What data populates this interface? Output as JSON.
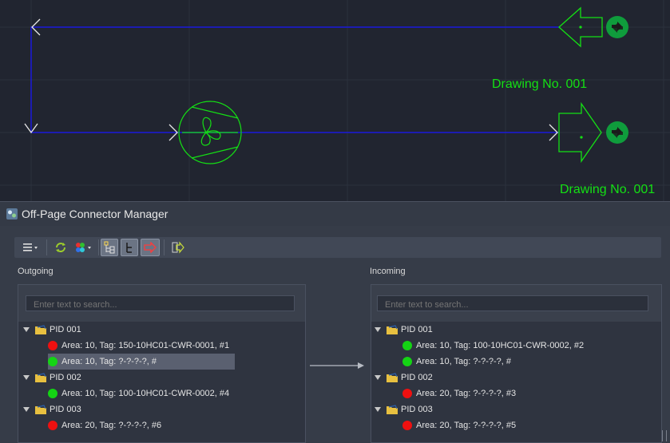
{
  "canvas": {
    "labels": [
      "Drawing No. 001",
      "Drawing No. 001"
    ],
    "line_color": "#1a1adc",
    "symbol_color": "#14e014",
    "background": "#212530"
  },
  "window": {
    "title": "Off-Page Connector Manager"
  },
  "toolbar": {
    "buttons": [
      "menu-icon",
      "refresh-icon",
      "color-icon",
      "tree-view-icon",
      "tree-branch-icon",
      "connector-arrow-icon",
      "export-icon"
    ]
  },
  "outgoing": {
    "label": "Outgoing",
    "search_placeholder": "Enter text to search...",
    "groups": [
      {
        "name": "PID 001",
        "items": [
          {
            "text": "Area: 10, Tag: 150-10HC01-CWR-0001, #1",
            "status": "red"
          },
          {
            "text": "Area: 10, Tag: ?-?-?-?, #",
            "status": "green",
            "selected": true
          }
        ]
      },
      {
        "name": "PID 002",
        "items": [
          {
            "text": "Area: 10, Tag: 100-10HC01-CWR-0002, #4",
            "status": "green"
          }
        ]
      },
      {
        "name": "PID 003",
        "items": [
          {
            "text": "Area: 20, Tag: ?-?-?-?, #6",
            "status": "red"
          }
        ]
      }
    ]
  },
  "incoming": {
    "label": "Incoming",
    "search_placeholder": "Enter text to search...",
    "groups": [
      {
        "name": "PID 001",
        "items": [
          {
            "text": "Area: 10, Tag: 100-10HC01-CWR-0002, #2",
            "status": "green"
          },
          {
            "text": "Area: 10, Tag: ?-?-?-?, #",
            "status": "green"
          }
        ]
      },
      {
        "name": "PID 002",
        "items": [
          {
            "text": "Area: 20, Tag: ?-?-?-?, #3",
            "status": "red"
          }
        ]
      },
      {
        "name": "PID 003",
        "items": [
          {
            "text": "Area: 20, Tag: ?-?-?-?, #5",
            "status": "red"
          }
        ]
      }
    ]
  }
}
